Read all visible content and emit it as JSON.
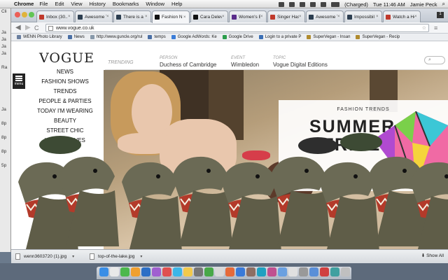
{
  "menubar": {
    "app_name": "Chrome",
    "items": [
      "File",
      "Edit",
      "View",
      "History",
      "Bookmarks",
      "Window",
      "Help"
    ],
    "battery": "(Charged)",
    "clock": "Tue 11:46 AM",
    "user": "Jamie Peck"
  },
  "behind_window": {
    "lines": [
      "Cli",
      "",
      "",
      "Ja",
      "Ja",
      "Ja",
      "Ja",
      "",
      "Ra",
      "",
      "",
      "",
      "",
      "",
      "Ja",
      "",
      "8p",
      "",
      "8p",
      "",
      "8p",
      "",
      "5p"
    ]
  },
  "tabs": [
    {
      "label": "Inbox (30...",
      "color": "#c0392b"
    },
    {
      "label": "Awesome T",
      "color": "#2c3e50"
    },
    {
      "label": "There is a l",
      "color": "#2c3e50"
    },
    {
      "label": "Fashion N",
      "color": "#111111"
    },
    {
      "label": "Cara Delev",
      "color": "#111111"
    },
    {
      "label": "Women's B",
      "color": "#5b2d8b"
    },
    {
      "label": "Singer Has",
      "color": "#c0392b"
    },
    {
      "label": "Awesome T",
      "color": "#2c3e50"
    },
    {
      "label": "Impossibil",
      "color": "#2c3e50"
    },
    {
      "label": "Watch a He",
      "color": "#c0392b"
    }
  ],
  "toolbar": {
    "back": "◀",
    "forward": "▶",
    "reload": "C",
    "url": "www.vogue.co.uk",
    "star": "☆"
  },
  "bookmarks": [
    {
      "label": "WENN Photo Library",
      "color": "#6a7fa0"
    },
    {
      "label": "News",
      "color": "#4a6fa5"
    },
    {
      "label": "http://www.guncle.org/rul",
      "color": "#8899aa"
    },
    {
      "label": "temps",
      "color": "#4a6fa5"
    },
    {
      "label": "Google AdWords: Ke",
      "color": "#3b7dd8"
    },
    {
      "label": "Google Drive",
      "color": "#2a9d4b"
    },
    {
      "label": "Login to a private P",
      "color": "#3b6fb5"
    },
    {
      "label": "SuperVegan - Insan",
      "color": "#b08b2e"
    },
    {
      "label": "SuperVegan - Recip",
      "color": "#b08b2e"
    }
  ],
  "vogue": {
    "logo": "VOGUE",
    "menu_label": "menu",
    "nav": [
      "NEWS",
      "FASHION SHOWS",
      "TRENDS",
      "PEOPLE & PARTIES",
      "TODAY I'M WEARING",
      "BEAUTY",
      "STREET CHIC",
      "VOGUE LOVES"
    ],
    "trending_label": "TRENDING",
    "topnav": [
      {
        "kind": "PERSON",
        "value": "Duchess of Cambridge"
      },
      {
        "kind": "EVENT",
        "value": "Wimbledon"
      },
      {
        "kind": "TOPIC",
        "value": "Vogue Digital Editions"
      }
    ],
    "search_icon": "search-icon",
    "feature_label": "FASHION TRENDS",
    "feature_title_1": "SUMMER",
    "feature_title_2": "STRIPES"
  },
  "downloads": {
    "files": [
      "wenn3603720 (1).jpg",
      "top-of-the-lake.jpg"
    ],
    "show_all": "Show All"
  }
}
